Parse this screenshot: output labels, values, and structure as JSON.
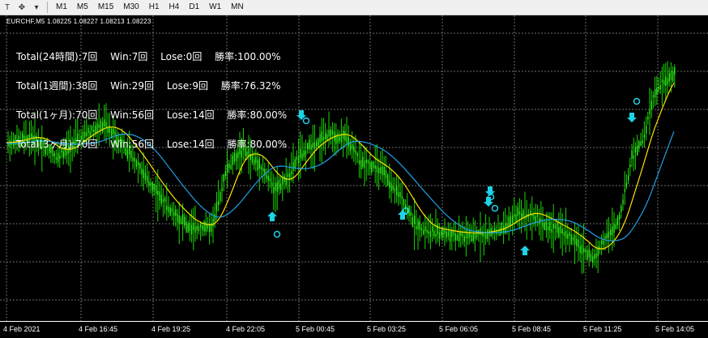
{
  "toolbar": {
    "icons": [
      "text-tool-icon",
      "objects-tool-icon",
      "dropdown-arrow-icon"
    ],
    "timeframes": [
      "M1",
      "M5",
      "M15",
      "M30",
      "H1",
      "H4",
      "D1",
      "W1",
      "MN"
    ]
  },
  "chart": {
    "symbol_line": "EURCHF,M5  1.08225 1.08227 1.08213 1.08223",
    "stats": [
      "Total(24時間):7回　 Win:7回　 Lose:0回　 勝率:100.00%",
      "Total(1週間):38回　 Win:29回　 Lose:9回　 勝率:76.32%",
      "Total(1ヶ月):70回　 Win:56回　 Lose:14回　 勝率:80.00%",
      "Total(3ヶ月):70回　 Win:56回　 Lose:14回　 勝率:80.00%"
    ],
    "x_ticks": [
      "4 Feb 2021",
      "4 Feb 16:45",
      "4 Feb 19:25",
      "4 Feb 22:05",
      "5 Feb 00:45",
      "5 Feb 03:25",
      "5 Feb 06:05",
      "5 Feb 08:45",
      "5 Feb 11:25",
      "5 Feb 14:05"
    ],
    "colors": {
      "candles": "#19d900",
      "fast_ma": "#ffe100",
      "slow_ma": "#1ea0e6",
      "signals": "#1ed3e6",
      "grid": "#6e6e6e"
    }
  }
}
